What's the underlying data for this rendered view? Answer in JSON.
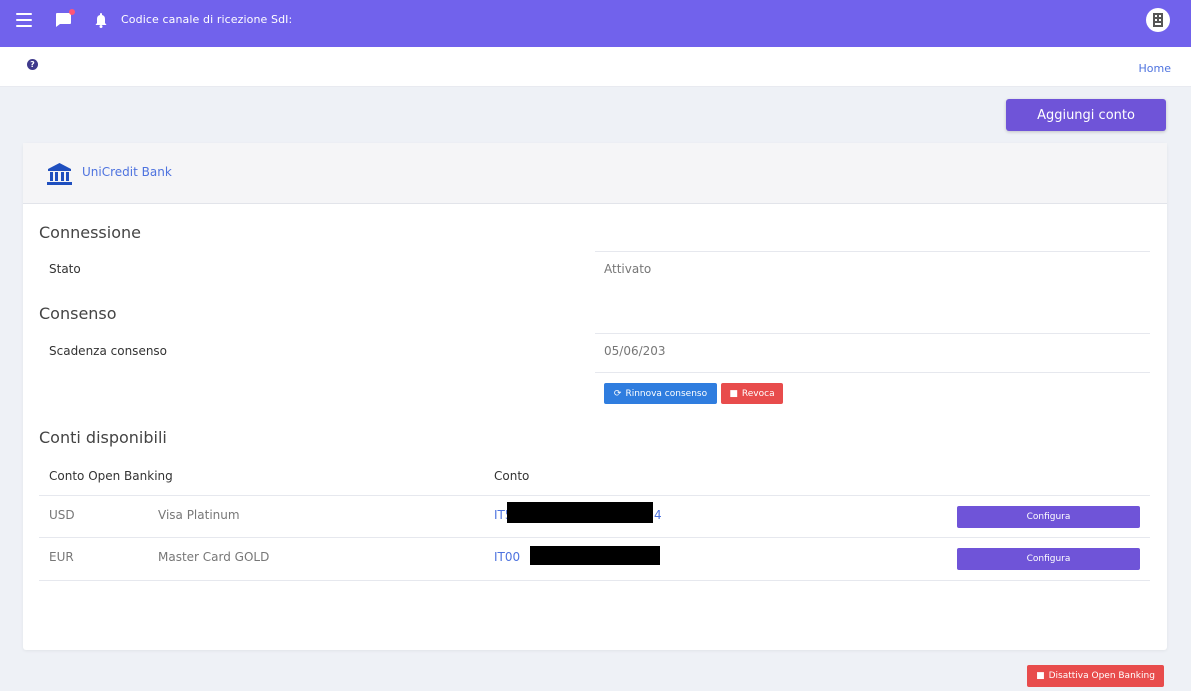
{
  "topbar": {
    "sdi_label": "Codice canale di ricezione SdI:"
  },
  "subbar": {
    "home_label": "Home"
  },
  "actions": {
    "add_account": "Aggiungi conto",
    "deactivate": "Disattiva Open Banking"
  },
  "bank": {
    "name": "UniCredit Bank"
  },
  "connection": {
    "title": "Connessione",
    "status_label": "Stato",
    "status_value": "Attivato"
  },
  "consent": {
    "title": "Consenso",
    "expiry_label": "Scadenza consenso",
    "expiry_value": "05/06/203",
    "renew_label": "Rinnova consenso",
    "revoke_label": "Revoca"
  },
  "accounts": {
    "title": "Conti disponibili",
    "header_open_banking": "Conto Open Banking",
    "header_account": "Conto",
    "rows": [
      {
        "currency": "USD",
        "name": "Visa Platinum",
        "iban_start": "IT5",
        "iban_end": "4",
        "action": "Configura"
      },
      {
        "currency": "EUR",
        "name": "Master Card GOLD",
        "iban_start": "IT00",
        "iban_end": "",
        "action": "Configura"
      }
    ]
  },
  "colors": {
    "topbar": "#7162ec",
    "primary_button": "#6f54d8",
    "danger": "#e84c4c",
    "info": "#2f7ddf",
    "link": "#4e73df"
  }
}
